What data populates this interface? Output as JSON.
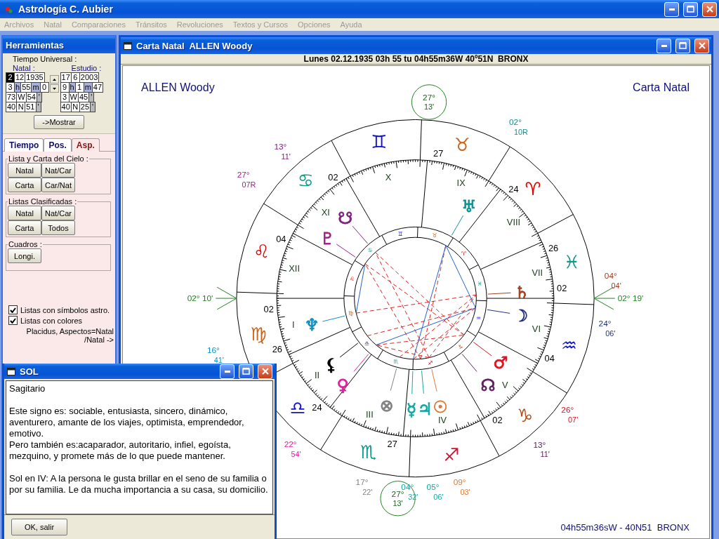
{
  "app": {
    "title": "Astrología C. Aubier"
  },
  "menu": [
    "Archivos",
    "Natal",
    "Comparaciones",
    "Tránsitos",
    "Revoluciones",
    "Textos y Cursos",
    "Opciones",
    "Ayuda"
  ],
  "tools": {
    "title": "Herramientas",
    "time_label": "Tiempo Universal :",
    "natal": {
      "label": "Natal :",
      "rows": [
        [
          {
            "text": "2",
            "kind": "selected"
          },
          {
            "text": "12",
            "kind": "value"
          },
          {
            "text": "1935",
            "kind": "value"
          }
        ],
        [
          {
            "text": "3",
            "kind": "value"
          },
          {
            "text": "h",
            "kind": "unit"
          },
          {
            "text": "55",
            "kind": "value"
          },
          {
            "text": "m",
            "kind": "unit"
          },
          {
            "text": "0",
            "kind": "value"
          }
        ],
        [
          {
            "text": "73",
            "kind": "value"
          },
          {
            "text": "W",
            "kind": "value"
          },
          {
            "text": "54",
            "kind": "value"
          },
          {
            "text": "'",
            "kind": "tick"
          }
        ],
        [
          {
            "text": "40",
            "kind": "value"
          },
          {
            "text": "N",
            "kind": "value"
          },
          {
            "text": "51",
            "kind": "value"
          },
          {
            "text": "'",
            "kind": "tick"
          }
        ]
      ]
    },
    "estudio": {
      "label": "Estudio :",
      "rows": [
        [
          {
            "text": "17",
            "kind": "value"
          },
          {
            "text": "6",
            "kind": "value"
          },
          {
            "text": "2003",
            "kind": "value"
          }
        ],
        [
          {
            "text": "9",
            "kind": "value"
          },
          {
            "text": "h",
            "kind": "unit"
          },
          {
            "text": "1",
            "kind": "value"
          },
          {
            "text": "m",
            "kind": "unit"
          },
          {
            "text": "47",
            "kind": "value"
          }
        ],
        [
          {
            "text": "3",
            "kind": "value"
          },
          {
            "text": "W",
            "kind": "value"
          },
          {
            "text": "45",
            "kind": "value"
          },
          {
            "text": "'",
            "kind": "tick"
          }
        ],
        [
          {
            "text": "40",
            "kind": "value"
          },
          {
            "text": "N",
            "kind": "value"
          },
          {
            "text": "25",
            "kind": "value"
          },
          {
            "text": "'",
            "kind": "tick"
          }
        ]
      ]
    },
    "show_button": "->Mostrar",
    "tabs": [
      {
        "label": "Tiempo",
        "selected": false
      },
      {
        "label": "Pos.",
        "selected": false
      },
      {
        "label": "Asp.",
        "selected": true
      }
    ],
    "groups": [
      {
        "title": "Lista y Carta del Cielo :",
        "buttons": [
          "Natal",
          "Nat/Car",
          "Carta",
          "Car/Nat"
        ]
      },
      {
        "title": "Listas Clasificadas :",
        "buttons": [
          "Natal",
          "Nat/Car",
          "Carta",
          "Todos"
        ]
      },
      {
        "title": "Cuadros :",
        "buttons": [
          "Longi."
        ]
      }
    ],
    "checkboxes": [
      {
        "label": "Listas con símbolos astro.",
        "checked": true
      },
      {
        "label": "Listas con colores",
        "checked": true
      }
    ],
    "footer": [
      "Placidus, Aspectos=Natal",
      "/Natal ->"
    ]
  },
  "chart_window": {
    "title": "Carta Natal  ALLEN Woody",
    "header": "Lunes 02.12.1935 03h 55 tu 04h55m36W 40º51N  BRONX",
    "name": "ALLEN Woody",
    "chart_title": "Carta Natal",
    "footer": "04h55m36sW - 40N51  BRONX",
    "wheel": {
      "signs": [
        {
          "glyph": "♊",
          "color": "#1010d0"
        },
        {
          "glyph": "♉",
          "color": "#c8661e"
        },
        {
          "glyph": "♋",
          "color": "#109a8a"
        },
        {
          "glyph": "♈",
          "color": "#e00000"
        },
        {
          "glyph": "♌",
          "color": "#e00000"
        },
        {
          "glyph": "♓",
          "color": "#109a8a"
        },
        {
          "glyph": "♍",
          "color": "#c8661e"
        },
        {
          "glyph": "♒",
          "color": "#1010d0"
        },
        {
          "glyph": "♎",
          "color": "#1010d0"
        },
        {
          "glyph": "♑",
          "color": "#b0501e"
        },
        {
          "glyph": "♏",
          "color": "#109a8a"
        },
        {
          "glyph": "♐",
          "color": "#d81030"
        }
      ],
      "inner_signs": [
        "♊",
        "♉",
        "♋",
        "♈",
        "♌",
        "♓",
        "♍",
        "♒",
        "♎",
        "♑",
        "♏",
        "♐"
      ],
      "house_numerals": [
        "X",
        "IX",
        "XI",
        "VIII",
        "XII",
        "VII",
        "I",
        "VI",
        "II",
        "V",
        "III",
        "IV"
      ],
      "cusp_degrees": [
        "27",
        "02",
        "24",
        "04",
        "26",
        "02",
        "02",
        "26",
        "04",
        "24",
        "02",
        "27"
      ],
      "angles": {
        "asc": {
          "deg": "02°",
          "min": "10'"
        },
        "dsc": {
          "deg": "02°",
          "min": "19'"
        },
        "mc": {
          "deg": "27°",
          "min": "13'"
        },
        "ic": {
          "deg": "27°",
          "min": "13'"
        }
      },
      "planets": [
        {
          "glyph": "☋",
          "color": "#802080"
        },
        {
          "glyph": "♅",
          "color": "#109090"
        },
        {
          "glyph": "♇",
          "color": "#a0208a"
        },
        {
          "glyph": "♄",
          "color": "#a04020"
        },
        {
          "glyph": "♆",
          "color": "#1090c0"
        },
        {
          "glyph": "☽",
          "color": "#203080"
        },
        {
          "glyph": "⚸",
          "color": "#000000"
        },
        {
          "glyph": "♂",
          "color": "#e01020"
        },
        {
          "glyph": "♀",
          "color": "#e020a0"
        },
        {
          "glyph": "☊",
          "color": "#602060"
        },
        {
          "glyph": "⊗",
          "color": "#808080"
        },
        {
          "glyph": "☿",
          "color": "#10a8a0"
        },
        {
          "glyph": "♃",
          "color": "#10a8a0"
        },
        {
          "glyph": "☉",
          "color": "#e07830"
        }
      ],
      "degree_labels": [
        {
          "deg": "02°",
          "min": "10R",
          "color": "#109090"
        },
        {
          "deg": "13°",
          "min": "11'",
          "color": "#802080"
        },
        {
          "deg": "27°",
          "min": "07R",
          "color": "#a0208a"
        },
        {
          "deg": "04°",
          "min": "04'",
          "color": "#a04020"
        },
        {
          "deg": "24°",
          "min": "06'",
          "color": "#203080"
        },
        {
          "deg": "16°",
          "min": "41'",
          "color": "#1090c0"
        },
        {
          "deg": "26°",
          "min": "07'",
          "color": "#e01020"
        },
        {
          "deg": "22°",
          "min": "54'",
          "color": "#e020a0"
        },
        {
          "deg": "13°",
          "min": "11'",
          "color": "#602060"
        },
        {
          "deg": "17°",
          "min": "22'",
          "color": "#808080"
        },
        {
          "deg": "04°",
          "min": "32'",
          "color": "#10a8a0"
        },
        {
          "deg": "05°",
          "min": "06'",
          "color": "#10a8a0"
        },
        {
          "deg": "09°",
          "min": "03'",
          "color": "#e07830"
        }
      ]
    }
  },
  "dialog": {
    "title": "SOL",
    "blocks": [
      [
        "Sagitario"
      ],
      [
        "Este signo es: sociable, entusiasta, sincero, dinámico, aventurero, amante de los viajes, optimista, emprendedor, emotivo.",
        "Pero también es:acaparador, autoritario, infiel, egoísta, mezquino, y promete más de lo que puede mantener."
      ],
      [
        "Sol en IV: A la persona le gusta brillar en el seno de su familia o por su familia. Le da mucha importancia a su casa, su domicilio."
      ]
    ],
    "button": "OK, salir"
  }
}
